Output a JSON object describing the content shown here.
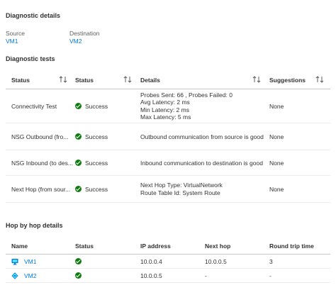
{
  "diagnostic_details": {
    "title": "Diagnostic details",
    "source_label": "Source",
    "source_value": "VM1",
    "destination_label": "Destination",
    "destination_value": "VM2"
  },
  "diagnostic_tests": {
    "title": "Diagnostic tests",
    "headers": [
      "Status",
      "Status",
      "Details",
      "Suggestions"
    ],
    "rows": [
      {
        "name": "Connectivity Test",
        "status": "Success",
        "details": [
          "Probes Sent: 66 , Probes Failed: 0",
          "Avg Latency: 2 ms",
          "Min Latency: 2 ms",
          "Max Latency: 5 ms"
        ],
        "suggestions": "None"
      },
      {
        "name": "NSG Outbound (fro...",
        "status": "Success",
        "details": [
          "Outbound communication from source is good"
        ],
        "suggestions": "None"
      },
      {
        "name": "NSG Inbound (to des...",
        "status": "Success",
        "details": [
          "Inbound communication to destination is good"
        ],
        "suggestions": "None"
      },
      {
        "name": "Next Hop (from sour...",
        "status": "Success",
        "details": [
          "Next Hop Type: VirtualNetwork",
          "Route Table Id: System Route"
        ],
        "suggestions": "None"
      }
    ]
  },
  "hop_details": {
    "title": "Hop by hop details",
    "headers": [
      "Name",
      "Status",
      "IP address",
      "Next hop",
      "Round trip time"
    ],
    "rows": [
      {
        "name": "VM1",
        "icon": "vm-monitor-icon",
        "ip": "10.0.0.4",
        "next_hop": "10.0.0.5",
        "rtt": "3"
      },
      {
        "name": "VM2",
        "icon": "vm-network-icon",
        "ip": "10.0.0.5",
        "next_hop": "-",
        "rtt": "-"
      }
    ]
  },
  "colors": {
    "link": "#0078d4",
    "success": "#107c10",
    "text": "#323130",
    "divider": "#edebe9"
  }
}
